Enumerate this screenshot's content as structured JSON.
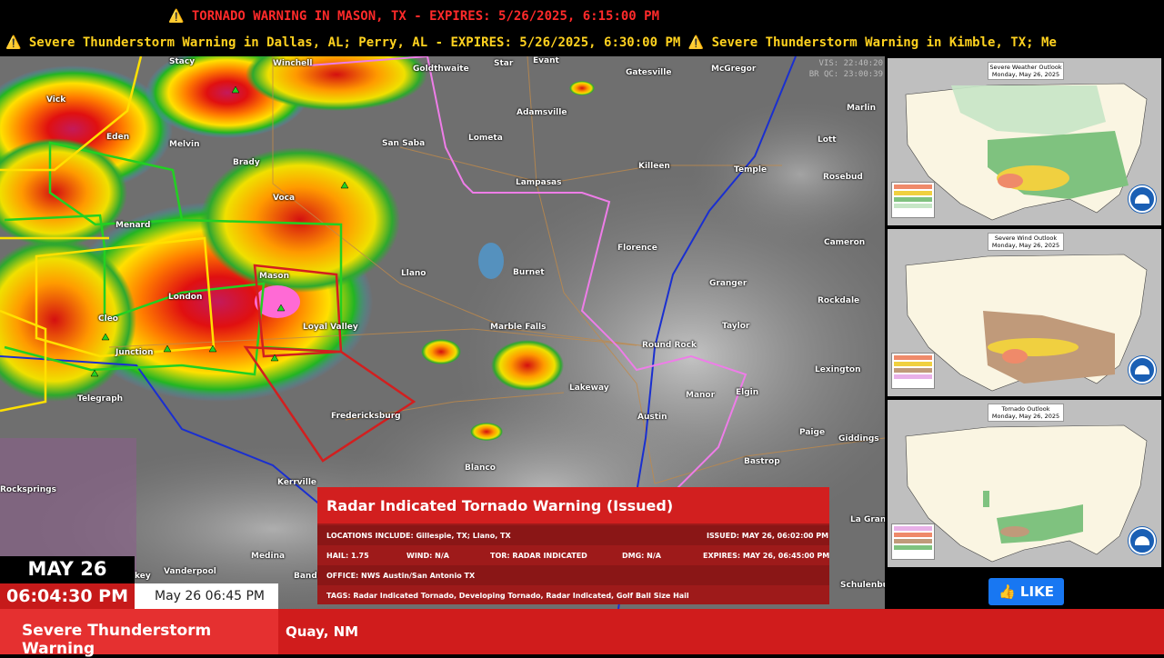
{
  "top_ticker": {
    "primary": "⚠️ TORNADO WARNING IN MASON, TX - EXPIRES: 5/26/2025, 6:15:00 PM",
    "secondary": "⚠️ Severe Thunderstorm Warning in Dallas, AL; Perry, AL - EXPIRES: 5/26/2025, 6:30:00 PM   ⚠️ Severe Thunderstorm Warning in Kimble, TX; Me"
  },
  "map": {
    "timestamps": [
      "VIS: 22:40:20",
      "BR QC: 23:00:39"
    ],
    "cities": [
      {
        "name": "Stacy"
      },
      {
        "name": "Winchell"
      },
      {
        "name": "Goldthwaite"
      },
      {
        "name": "Star"
      },
      {
        "name": "Evant"
      },
      {
        "name": "Gatesville"
      },
      {
        "name": "McGregor"
      },
      {
        "name": "Vick"
      },
      {
        "name": "Eden"
      },
      {
        "name": "Melvin"
      },
      {
        "name": "San Saba"
      },
      {
        "name": "Lometa"
      },
      {
        "name": "Adamsville"
      },
      {
        "name": "Marlin"
      },
      {
        "name": "Lott"
      },
      {
        "name": "Brady"
      },
      {
        "name": "Voca"
      },
      {
        "name": "Killeen"
      },
      {
        "name": "Temple"
      },
      {
        "name": "Rosebud"
      },
      {
        "name": "Lampasas"
      },
      {
        "name": "Menard"
      },
      {
        "name": "Mason"
      },
      {
        "name": "Llano"
      },
      {
        "name": "Florence"
      },
      {
        "name": "Cameron"
      },
      {
        "name": "Burnet"
      },
      {
        "name": "Granger"
      },
      {
        "name": "London"
      },
      {
        "name": "Rockdale"
      },
      {
        "name": "Cleo"
      },
      {
        "name": "Loyal Valley"
      },
      {
        "name": "Marble Falls"
      },
      {
        "name": "Taylor"
      },
      {
        "name": "Junction"
      },
      {
        "name": "Round Rock"
      },
      {
        "name": "Lexington"
      },
      {
        "name": "Telegraph"
      },
      {
        "name": "Lakeway"
      },
      {
        "name": "Manor"
      },
      {
        "name": "Elgin"
      },
      {
        "name": "Fredericksburg"
      },
      {
        "name": "Paige"
      },
      {
        "name": "Austin"
      },
      {
        "name": "Giddings"
      },
      {
        "name": "Blanco"
      },
      {
        "name": "Bastrop"
      },
      {
        "name": "Rocksprings"
      },
      {
        "name": "Kerrville"
      },
      {
        "name": "La Gran"
      },
      {
        "name": "Medina"
      },
      {
        "name": "Vanderpool"
      },
      {
        "name": "Bande"
      },
      {
        "name": "Schulenbu"
      },
      {
        "name": "key"
      }
    ]
  },
  "alert": {
    "title": "Radar Indicated Tornado Warning (Issued)",
    "locations": "LOCATIONS INCLUDE: Gillespie, TX; Llano, TX",
    "issued": "ISSUED: MAY 26, 06:02:00 PM",
    "hail": "HAIL: 1.75",
    "wind": "WIND: N/A",
    "tor": "TOR: RADAR INDICATED",
    "dmg": "DMG: N/A",
    "expires": "EXPIRES: MAY 26, 06:45:00 PM",
    "office": "OFFICE: NWS Austin/San Antonio TX",
    "tags": "TAGS: Radar Indicated Tornado, Developing Tornado, Radar Indicated, Golf Ball Size Hail"
  },
  "outlooks": [
    {
      "title": "Severe Weather Outlook",
      "date": "Monday, May 26, 2025"
    },
    {
      "title": "Severe Wind Outlook",
      "date": "Monday, May 26, 2025"
    },
    {
      "title": "Tornado Outlook",
      "date": "Monday, May 26, 2025"
    }
  ],
  "like_button": "👍 LIKE",
  "clock": {
    "date": "MAY 26",
    "time": "06:04:30 PM",
    "expires": "May 26 06:45 PM"
  },
  "bottom": {
    "type": "Severe Thunderstorm Warning",
    "area": "Quay, NM"
  },
  "colors": {
    "tornado_red": "#d21f1f",
    "severe_yellow": "#ffd21f",
    "like_blue": "#1877f2"
  }
}
